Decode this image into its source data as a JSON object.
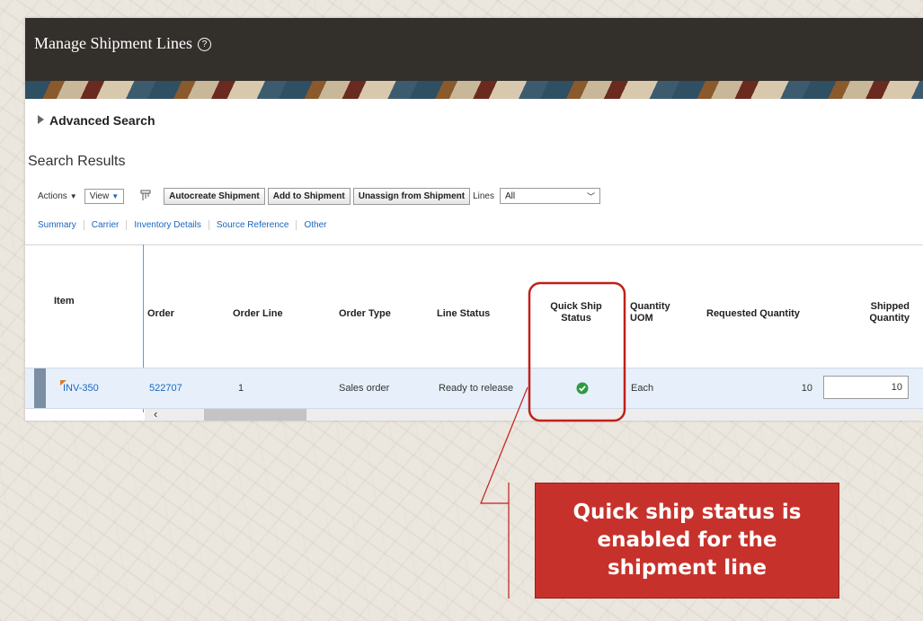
{
  "page": {
    "title": "Manage Shipment Lines",
    "help_icon": "help-circle-icon"
  },
  "advanced_search": {
    "label": "Advanced Search",
    "icon": "disclosure-triangle-icon"
  },
  "search_results": {
    "title": "Search Results"
  },
  "toolbar": {
    "actions_label": "Actions",
    "view_label": "View",
    "detach_icon": "detach-table-icon",
    "buttons": [
      "Autocreate Shipment",
      "Add to Shipment",
      "Unassign from Shipment"
    ],
    "lines_label": "Lines",
    "lines_value": "All"
  },
  "tabs": [
    "Summary",
    "Carrier",
    "Inventory Details",
    "Source Reference",
    "Other"
  ],
  "table": {
    "headers": {
      "item": "Item",
      "order": "Order",
      "order_line": "Order Line",
      "order_type": "Order Type",
      "line_status": "Line Status",
      "quick_ship_status_1": "Quick Ship",
      "quick_ship_status_2": "Status",
      "quantity_uom_1": "Quantity",
      "quantity_uom_2": "UOM",
      "requested_quantity": "Requested Quantity",
      "shipped_quantity_1": "Shipped",
      "shipped_quantity_2": "Quantity"
    },
    "rows": [
      {
        "item": "INV-350",
        "order": "522707",
        "order_line": "1",
        "order_type": "Sales order",
        "line_status": "Ready to release",
        "quick_ship_status": "check-circle-icon",
        "quantity_uom": "Each",
        "requested_quantity": "10",
        "shipped_quantity": "10"
      }
    ]
  },
  "callout": {
    "line1": "Quick ship status is",
    "line2": "enabled for the",
    "line3": "shipment line",
    "fill_color": "#c6322b",
    "highlight_color": "#c0201a"
  },
  "colors": {
    "header": "#332f2b",
    "link": "#1a66c2",
    "row_selected": "#e7f0fa",
    "check": "#2e9b3e"
  }
}
